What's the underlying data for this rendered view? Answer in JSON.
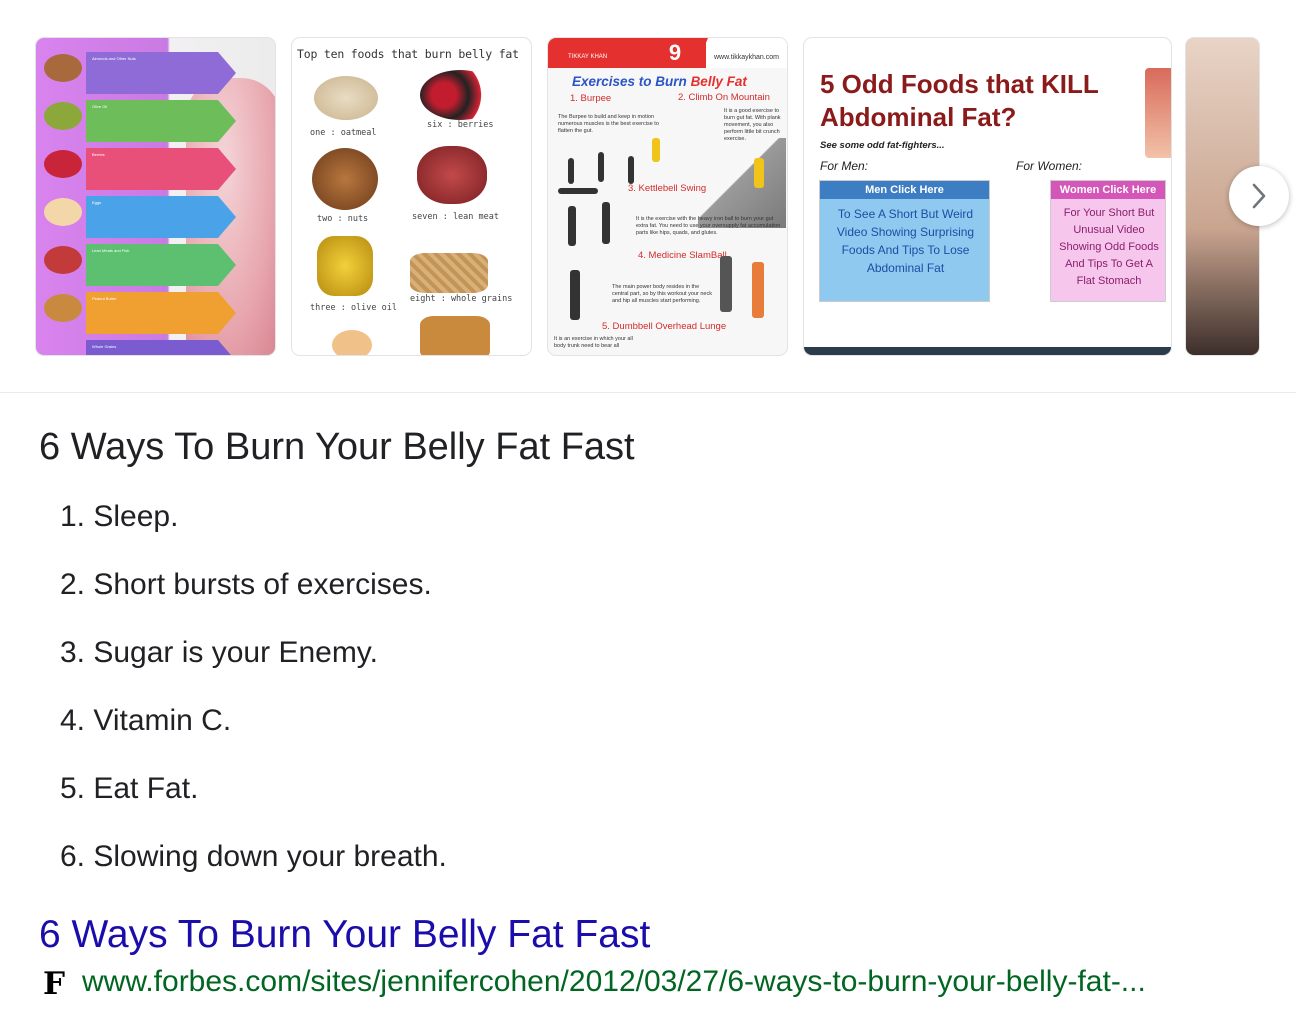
{
  "carousel": {
    "images": [
      {
        "name": "women-foods-infographic",
        "captions": [
          "Almonds and Other Nuts",
          "Olive Oil",
          "Berries",
          "Eggs",
          "Lean Meats and Fish",
          "Peanut Butter",
          "Whole Grains"
        ]
      },
      {
        "name": "top-ten-foods",
        "title": "Top ten foods that burn belly fat",
        "labels": [
          "one : oatmeal",
          "six : berries",
          "two : nuts",
          "seven : lean meat",
          "three : olive oil",
          "eight : whole grains"
        ]
      },
      {
        "name": "exercises-infographic",
        "badge": "9",
        "brand": "TIKKAY KHAN",
        "site": "www.tikkaykhan.com",
        "title_part1": "Exercises to Burn",
        "title_part2": "Belly Fat",
        "steps": [
          "1. Burpee",
          "2. Climb On Mountain",
          "3. Kettlebell Swing",
          "4. Medicine SlamBall",
          "5. Dumbbell Overhead Lunge"
        ]
      },
      {
        "name": "odd-foods-ad",
        "title_line1": "5 Odd Foods that KILL",
        "title_line2": "Abdominal Fat?",
        "subtitle": "See some odd fat-fighters...",
        "for_men": "For Men:",
        "for_women": "For Women:",
        "men_header": "Men Click Here",
        "men_text": "To See A Short But Weird Video Showing Surprising Foods And Tips To Lose Abdominal Fat",
        "women_header": "Women Click Here",
        "women_text": "For Your Short But Unusual Video Showing Odd Foods And Tips To Get A Flat Stomach"
      },
      {
        "name": "belly-photo"
      }
    ],
    "next_icon": "chevron-right-icon"
  },
  "snippet": {
    "heading": "6 Ways To Burn Your Belly Fat Fast",
    "items": [
      "1. Sleep.",
      "2. Short bursts of exercises.",
      "3. Sugar is your Enemy.",
      "4. Vitamin C.",
      "5. Eat Fat.",
      "6. Slowing down your breath."
    ]
  },
  "result": {
    "title": "6 Ways To Burn Your Belly Fat Fast",
    "favicon_letter": "F",
    "url": "www.forbes.com/sites/jennifercohen/2012/03/27/6-ways-to-burn-your-belly-fat-..."
  },
  "colors": {
    "link": "#1a0dab",
    "url": "#006621",
    "text": "#202124"
  }
}
